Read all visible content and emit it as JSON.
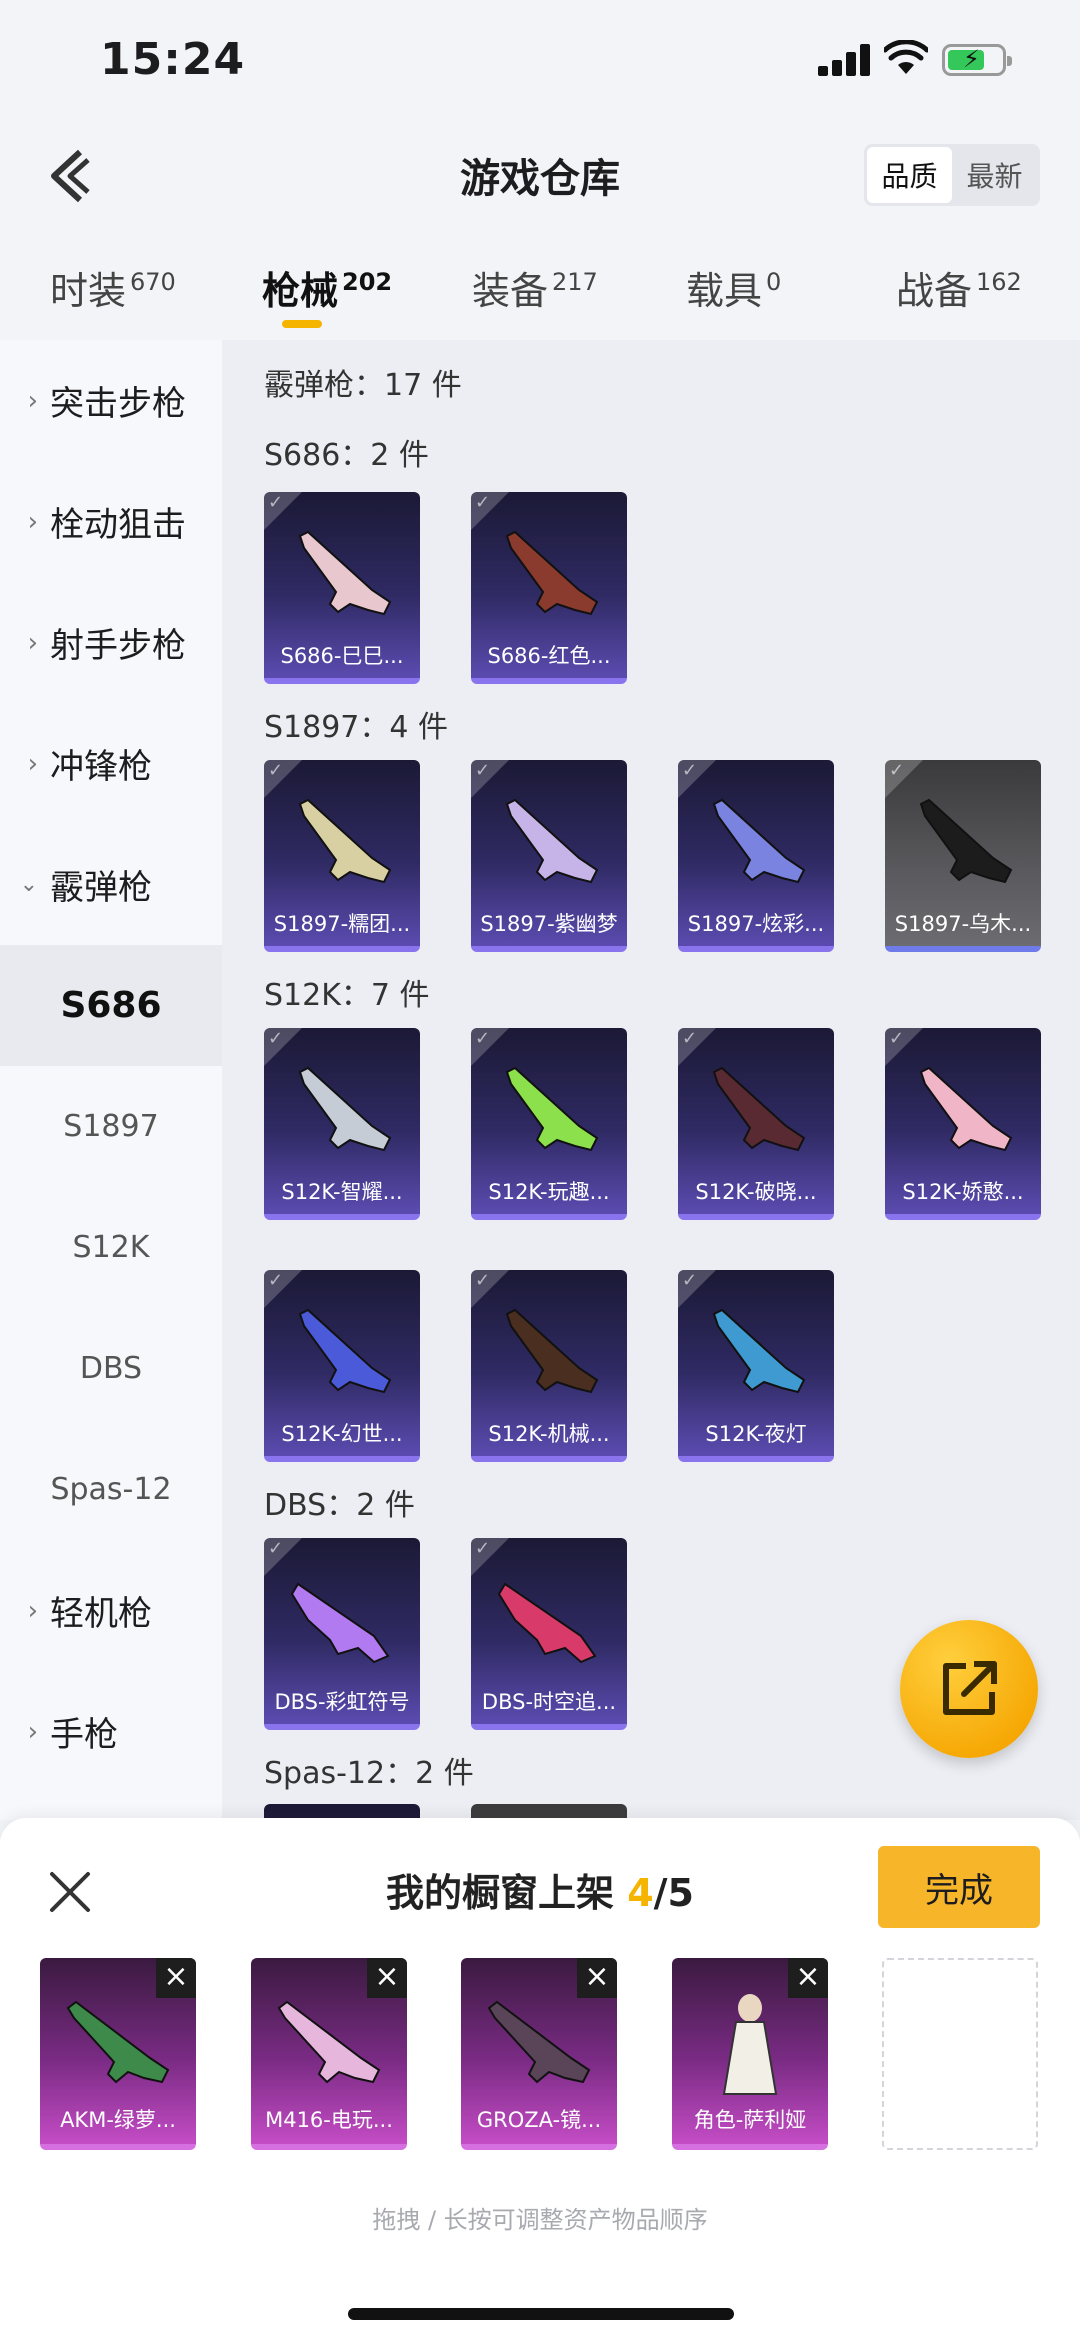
{
  "status": {
    "time": "15:24"
  },
  "header": {
    "title": "游戏仓库",
    "sort_quality": "品质",
    "sort_newest": "最新"
  },
  "tabs": [
    {
      "label": "时装",
      "count": "670"
    },
    {
      "label": "枪械",
      "count": "202"
    },
    {
      "label": "装备",
      "count": "217"
    },
    {
      "label": "载具",
      "count": "0"
    },
    {
      "label": "战备",
      "count": "162"
    }
  ],
  "sidebar": {
    "categories": [
      "突击步枪",
      "栓动狙击",
      "射手步枪",
      "冲锋枪",
      "霰弹枪",
      "轻机枪",
      "手枪"
    ],
    "subs": [
      "S686",
      "S1897",
      "S12K",
      "DBS",
      "Spas-12"
    ]
  },
  "content": {
    "category_header": "霰弹枪：17 件",
    "groups": [
      {
        "header": "S686：2 件",
        "items": [
          "S686-巳巳...",
          "S686-红色..."
        ]
      },
      {
        "header": "S1897：4 件",
        "items": [
          "S1897-糯团...",
          "S1897-紫幽梦",
          "S1897-炫彩...",
          "S1897-乌木..."
        ]
      },
      {
        "header": "S12K：7 件",
        "items": [
          "S12K-智耀...",
          "S12K-玩趣...",
          "S12K-破晓...",
          "S12K-娇憨...",
          "S12K-幻世...",
          "S12K-机械...",
          "S12K-夜灯"
        ]
      },
      {
        "header": "DBS：2 件",
        "items": [
          "DBS-彩虹符号",
          "DBS-时空追..."
        ]
      },
      {
        "header": "Spas-12：2 件",
        "items": []
      }
    ]
  },
  "sheet": {
    "title_prefix": "我的橱窗上架 ",
    "count": "4",
    "total": "/5",
    "done_label": "完成",
    "slots": [
      "AKM-绿萝...",
      "M416-电玩...",
      "GROZA-镜...",
      "角色-萨利娅"
    ],
    "hint": "拖拽 / 长按可调整资产物品顺序"
  }
}
